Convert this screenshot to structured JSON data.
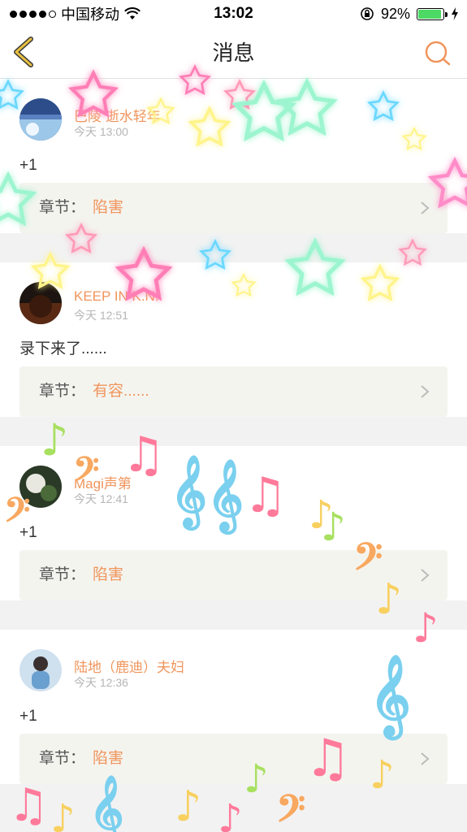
{
  "status_bar": {
    "carrier": "中国移动",
    "time": "13:02",
    "battery": "92%"
  },
  "nav": {
    "title": "消息"
  },
  "messages": [
    {
      "name": "巴陵    逝水轻年",
      "time": "今天 13:00",
      "content": "+1",
      "chapter_label": "章节：",
      "chapter_value": "陷害"
    },
    {
      "name": "KEEP IN K.N.",
      "time": "今天 12:51",
      "content": "录下来了......",
      "chapter_label": "章节：",
      "chapter_value": "有容......"
    },
    {
      "name": "Magi声第",
      "time": "今天 12:41",
      "content": "+1",
      "chapter_label": "章节：",
      "chapter_value": "陷害"
    },
    {
      "name": "陆地（鹿迪）夫妇",
      "time": "今天 12:36",
      "content": "+1",
      "chapter_label": "章节：",
      "chapter_value": "陷害"
    }
  ],
  "colors": {
    "accent": "#f0955c",
    "back_arrow": "#e0b030",
    "battery": "#4cd964"
  }
}
